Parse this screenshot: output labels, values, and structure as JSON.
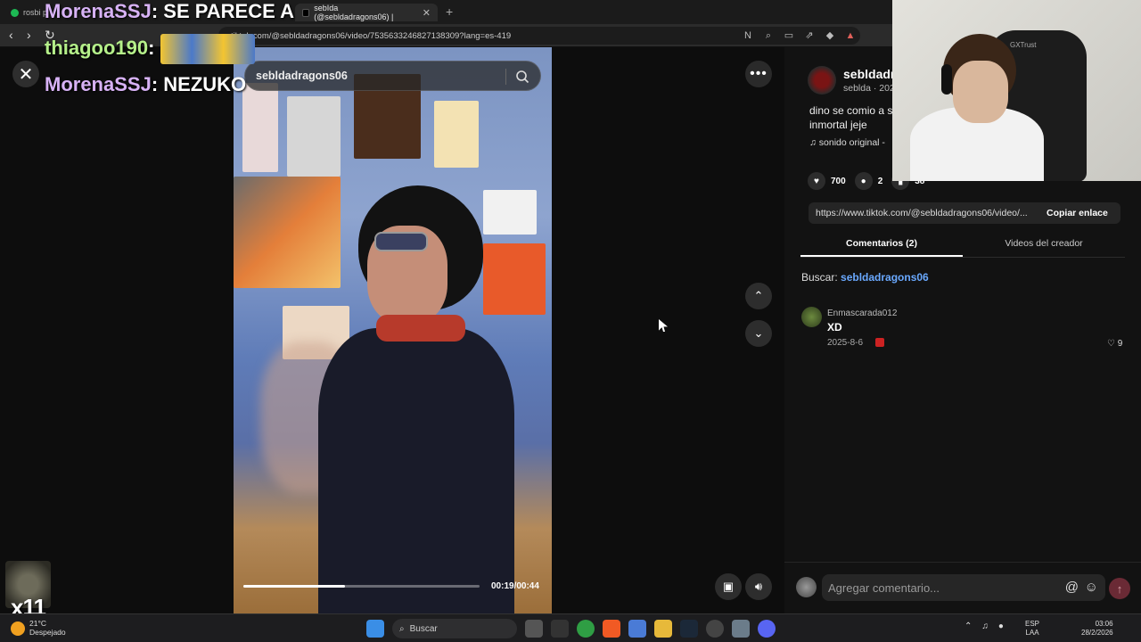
{
  "browser": {
    "tabs": [
      {
        "label": "rosbi p",
        "active": false
      },
      {
        "label": "sebIda (@sebldadragons06) |",
        "active": true
      }
    ],
    "url": "tiktok.com/@sebldadragons06/video/7535633246827138309?lang=es-419"
  },
  "chat_overlay": [
    {
      "user": "MorenaSSJ",
      "message": "SE PARECE A",
      "color": "#d7b2f5"
    },
    {
      "user": "thiagoo190",
      "message": "",
      "emote": "minions-emote",
      "color": "#b5f08a"
    },
    {
      "user": "MorenaSSJ",
      "message": "NEZUKO",
      "color": "#d7b2f5"
    }
  ],
  "player": {
    "search_text": "sebldadragons06",
    "current_time": "00:19",
    "duration": "00:44",
    "time_display": "00:19/00:44",
    "progress_fraction": 0.43
  },
  "post": {
    "author": "sebldadr",
    "author_sub": "seblda · 202",
    "description": "dino se comio a s inmortal jeje",
    "sound": "sonido original -",
    "likes": "700",
    "comments": "2",
    "saves": "38",
    "link": "https://www.tiktok.com/@sebldadragons06/video/...",
    "copy_label": "Copiar enlace"
  },
  "tabs": {
    "comments": "Comentarios (2)",
    "creator_videos": "Videos del creador"
  },
  "search_hint": {
    "prefix": "Buscar:",
    "query": "sebldadragons06"
  },
  "comments": [
    {
      "user": "Enmascarada012",
      "text": "XD",
      "date": "2025-8-6",
      "likes": "9"
    }
  ],
  "comment_bar": {
    "placeholder": "Agregar comentario...",
    "at": "@",
    "emoji": "☺"
  },
  "webcam": {
    "label": "GXTrust"
  },
  "corner_overlay": {
    "count": "x11"
  },
  "taskbar": {
    "temperature": "21°C",
    "weather": "Despejado",
    "search": "Buscar",
    "lang_top": "ESP",
    "lang_bottom": "LAA",
    "time": "03:06",
    "date": "28/2/2026"
  },
  "colors": {
    "accent": "#6aa9ff",
    "send_button": "#6a2a35",
    "chat_user_purple": "#d7b2f5",
    "chat_user_green": "#b5f08a"
  }
}
